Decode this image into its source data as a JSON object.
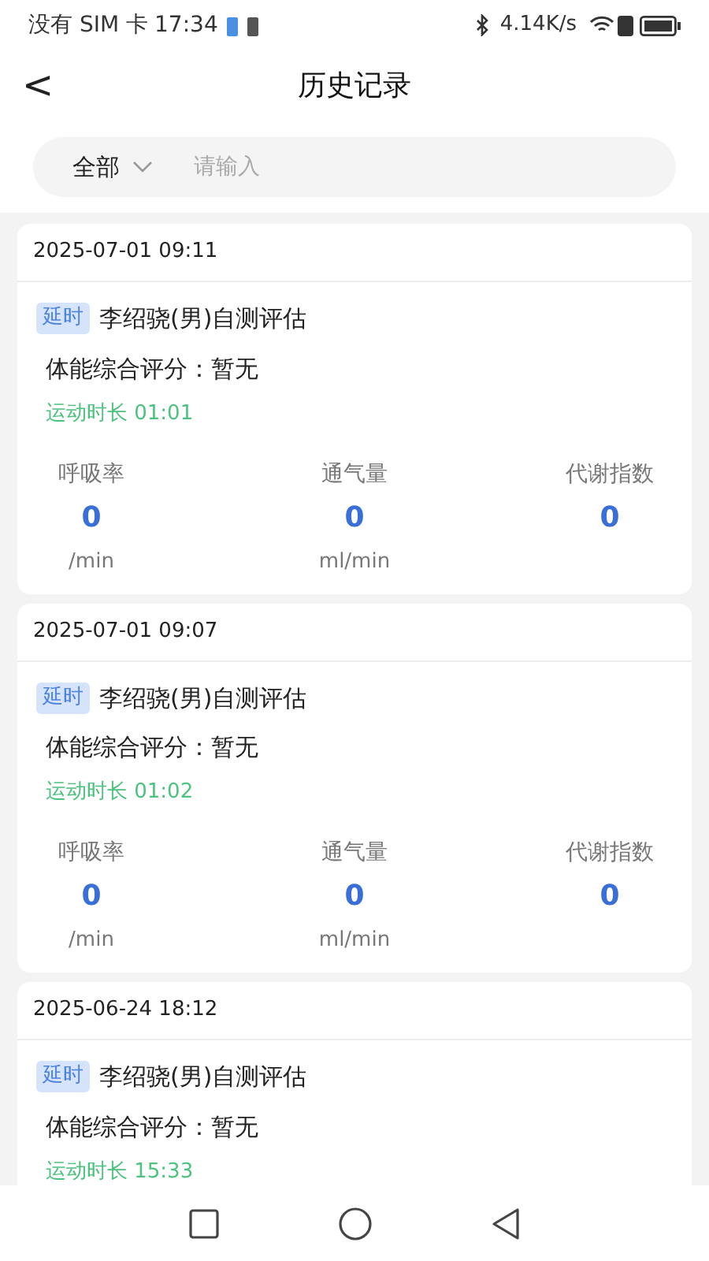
{
  "status_bar": {
    "carrier": "没有 SIM 卡",
    "time": "17:34",
    "speed": "4.14K/s"
  },
  "header": {
    "back": "<",
    "title": "历史记录"
  },
  "search": {
    "filter": "全部",
    "placeholder": "请输入"
  },
  "records": [
    {
      "datetime": "2025-07-01 09:11",
      "tag": "延时",
      "title": "李绍骁(男)自测评估",
      "score": "体能综合评分：暂无",
      "duration": "运动时长 01:01",
      "metrics": [
        {
          "label": "呼吸率",
          "value": "0",
          "unit": "/min"
        },
        {
          "label": "通气量",
          "value": "0",
          "unit": "ml/min"
        },
        {
          "label": "代谢指数",
          "value": "0"
        }
      ]
    },
    {
      "datetime": "2025-07-01 09:07",
      "tag": "延时",
      "title": "李绍骁(男)自测评估",
      "score": "体能综合评分：暂无",
      "duration": "运动时长 01:02",
      "metrics": [
        {
          "label": "呼吸率",
          "value": "0",
          "unit": "/min"
        },
        {
          "label": "通气量",
          "value": "0",
          "unit": "ml/min"
        },
        {
          "label": "代谢指数",
          "value": "0"
        }
      ]
    },
    {
      "datetime": "2025-06-24 18:12",
      "tag": "延时",
      "title": "李绍骁(男)自测评估",
      "score": "体能综合评分：暂无",
      "duration": "运动时长 15:33"
    }
  ]
}
